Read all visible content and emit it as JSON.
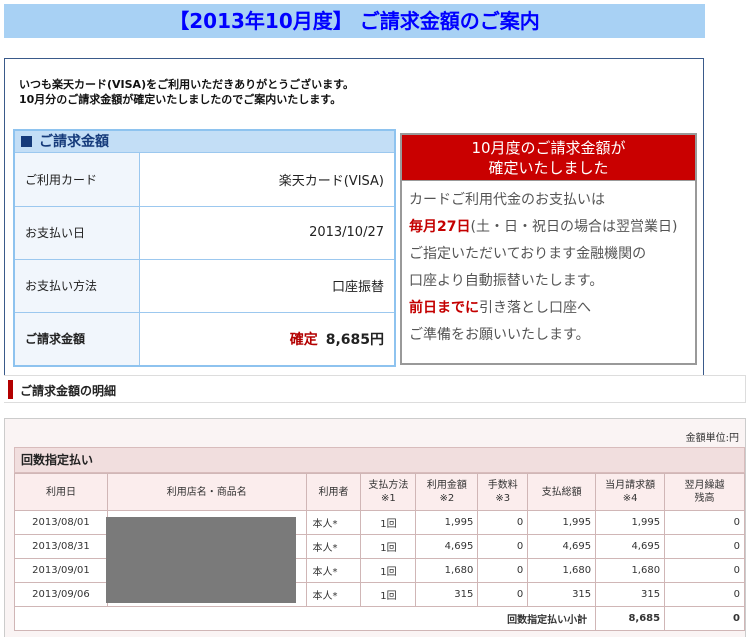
{
  "page": {
    "title": "【2013年10月度】 ご請求金額のご案内"
  },
  "notice": {
    "intro": "いつも楽天カード(VISA)をご利用いただきありがとうございます。\n10月分のご請求金額が確定いたしましたのでご案内いたします。"
  },
  "summary": {
    "header": "ご請求金額",
    "rows": [
      {
        "label": "ご利用カード",
        "value": "楽天カード(VISA)"
      },
      {
        "label": "お支払い日",
        "value": "2013/10/27"
      },
      {
        "label": "お支払い方法",
        "value": "口座振替"
      }
    ],
    "total_label": "ご請求金額",
    "total_status": "確定",
    "total_amount": "8,685円"
  },
  "info": {
    "head_line1": "10月度のご請求金額が",
    "head_line2": "確定いたしました",
    "line1": "カードご利用代金のお支払いは",
    "line2_red": "毎月27日",
    "line2_rest": "(土・日・祝日の場合は翌営業日)",
    "line3": "ご指定いただいております金融機関の",
    "line4": "口座より自動振替いたします。",
    "line5_red": "前日までに",
    "line5_rest": "引き落とし口座へ",
    "line6": "ご準備をお願いいたします。"
  },
  "colors": {
    "accent_red": "#c90000",
    "title_blue": "#0000ff",
    "title_bg": "#a8d1f4"
  },
  "detail": {
    "section_title": "ご請求金額の明細",
    "unit_note": "金額単位:円",
    "group_title": "回数指定払い",
    "columns": [
      "利用日",
      "利用店名・商品名",
      "利用者",
      "支払方法\n※1",
      "利用金額\n※2",
      "手数料\n※3",
      "支払総額",
      "当月請求額\n※4",
      "翌月繰越\n残高"
    ],
    "rows": [
      {
        "date": "2013/08/01",
        "user": "本人*",
        "method": "1回",
        "amount": "1,995",
        "fee": "0",
        "total": "1,995",
        "billed": "1,995",
        "carry": "0"
      },
      {
        "date": "2013/08/31",
        "user": "本人*",
        "method": "1回",
        "amount": "4,695",
        "fee": "0",
        "total": "4,695",
        "billed": "4,695",
        "carry": "0"
      },
      {
        "date": "2013/09/01",
        "user": "本人*",
        "method": "1回",
        "amount": "1,680",
        "fee": "0",
        "total": "1,680",
        "billed": "1,680",
        "carry": "0"
      },
      {
        "date": "2013/09/06",
        "user": "本人*",
        "method": "1回",
        "amount": "315",
        "fee": "0",
        "total": "315",
        "billed": "315",
        "carry": "0"
      }
    ],
    "subtotal_label": "回数指定払い小計",
    "subtotal_billed": "8,685",
    "subtotal_carry": "0"
  }
}
